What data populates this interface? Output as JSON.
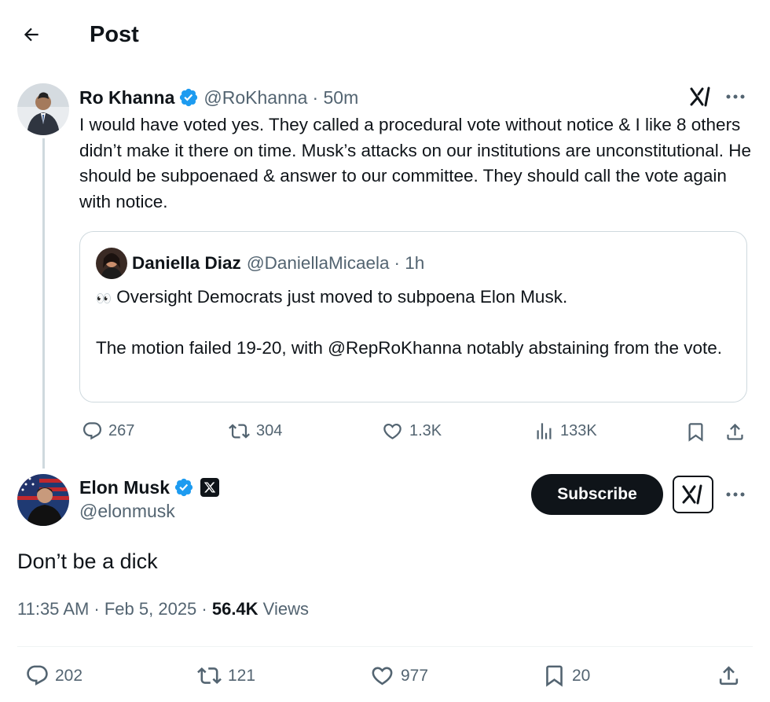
{
  "header": {
    "title": "Post"
  },
  "parent_tweet": {
    "author_name": "Ro Khanna",
    "author_handle": "@RoKhanna",
    "time": "· 50m",
    "text": "I would have voted yes. They called a procedural vote without notice & I like 8 others didn’t make it there on time. Musk’s attacks on our institutions are unconstitutional. He should be subpoenaed & answer to our committee. They should call the vote again with notice.",
    "quote": {
      "author_name": "Daniella Diaz",
      "author_handle": "@DaniellaMicaela",
      "time": "· 1h",
      "line1_emoji": "👀",
      "line1": "Oversight Democrats just moved to subpoena Elon Musk.",
      "line2": "The motion failed 19-20, with @RepRoKhanna notably abstaining from the vote."
    },
    "actions": {
      "replies": "267",
      "reposts": "304",
      "likes": "1.3K",
      "views": "133K"
    }
  },
  "main_tweet": {
    "author_name": "Elon Musk",
    "author_handle": "@elonmusk",
    "subscribe_label": "Subscribe",
    "text": "Don’t be a dick",
    "time": "11:35 AM · Feb 5, 2025 · ",
    "views_count": "56.4K",
    "views_label": " Views",
    "actions": {
      "replies": "202",
      "reposts": "121",
      "likes": "977",
      "bookmarks": "20"
    }
  },
  "colors": {
    "text": "#0f1419",
    "secondary": "#536471",
    "verified": "#1d9bf0",
    "border": "#cfd9de"
  }
}
